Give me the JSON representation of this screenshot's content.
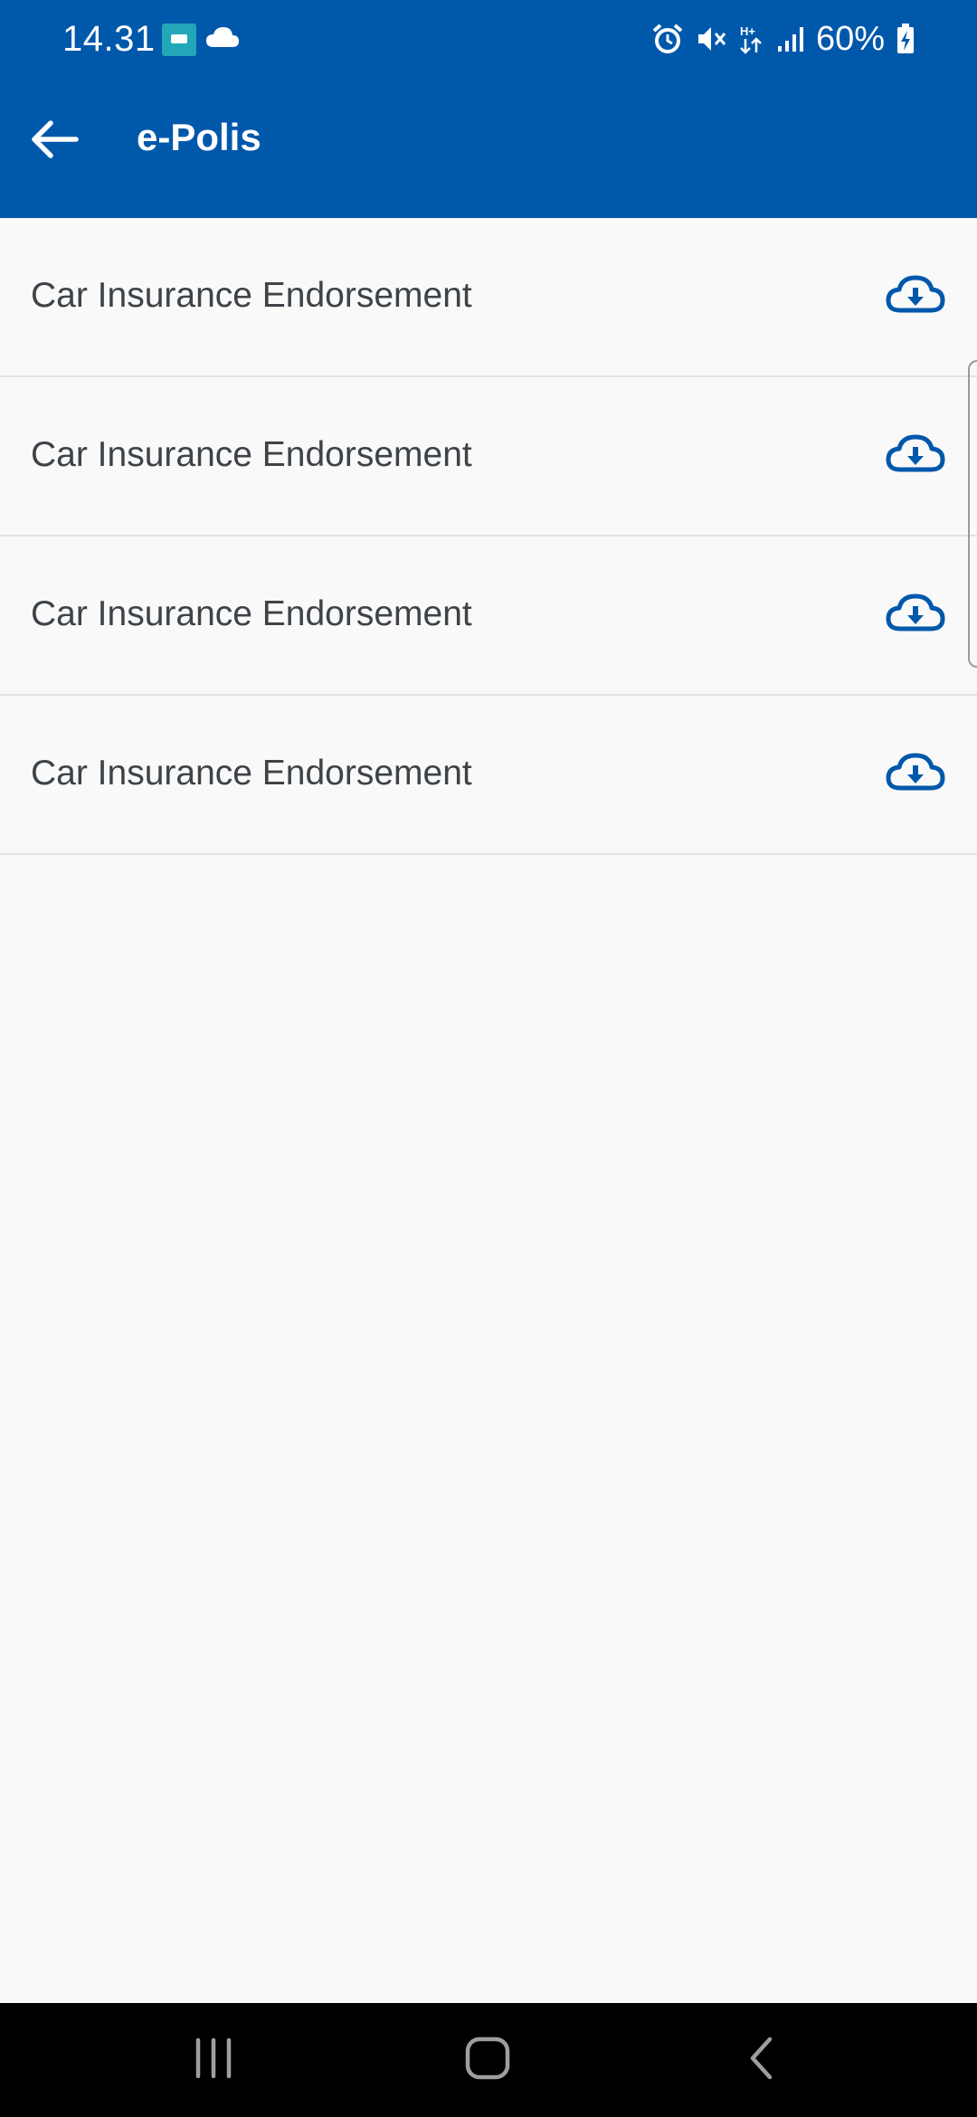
{
  "status_bar": {
    "time": "14.31",
    "battery": "60%",
    "icons": [
      "app-notification-icon",
      "cloud-icon",
      "alarm-icon",
      "mute-icon",
      "data-hplus-icon",
      "signal-icon",
      "battery-charging-icon"
    ]
  },
  "toolbar": {
    "title": "e-Polis",
    "back_icon": "arrow-left-icon"
  },
  "list": {
    "items": [
      {
        "label": "Car Insurance Endorsement",
        "action_icon": "cloud-download-icon"
      },
      {
        "label": "Car Insurance Endorsement",
        "action_icon": "cloud-download-icon"
      },
      {
        "label": "Car Insurance Endorsement",
        "action_icon": "cloud-download-icon"
      },
      {
        "label": "Car Insurance Endorsement",
        "action_icon": "cloud-download-icon"
      }
    ]
  },
  "nav_bar": {
    "icons": [
      "recents-icon",
      "home-icon",
      "back-icon"
    ]
  },
  "colors": {
    "primary": "#0058ab",
    "background": "#f9f9f9",
    "text": "#3d4348",
    "divider": "#e2e2e2",
    "nav_bar": "#000000"
  }
}
